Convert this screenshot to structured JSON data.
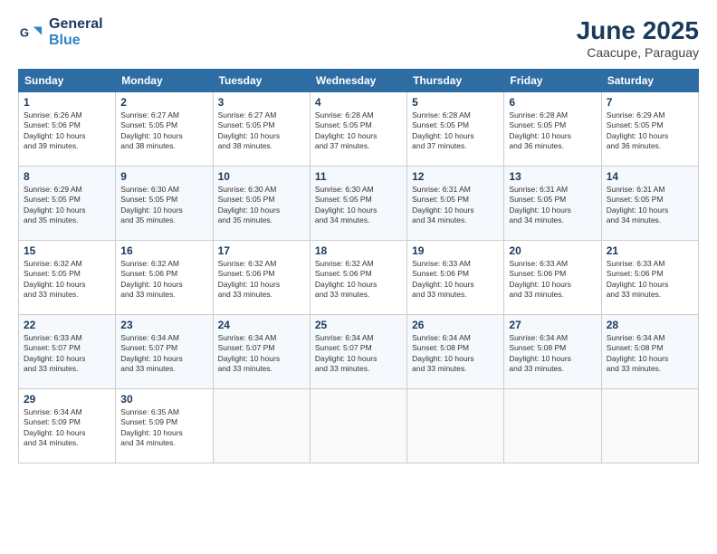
{
  "logo": {
    "line1": "General",
    "line2": "Blue"
  },
  "title": "June 2025",
  "subtitle": "Caacupe, Paraguay",
  "days_of_week": [
    "Sunday",
    "Monday",
    "Tuesday",
    "Wednesday",
    "Thursday",
    "Friday",
    "Saturday"
  ],
  "weeks": [
    [
      {
        "day": 1,
        "info": "Sunrise: 6:26 AM\nSunset: 5:06 PM\nDaylight: 10 hours\nand 39 minutes."
      },
      {
        "day": 2,
        "info": "Sunrise: 6:27 AM\nSunset: 5:05 PM\nDaylight: 10 hours\nand 38 minutes."
      },
      {
        "day": 3,
        "info": "Sunrise: 6:27 AM\nSunset: 5:05 PM\nDaylight: 10 hours\nand 38 minutes."
      },
      {
        "day": 4,
        "info": "Sunrise: 6:28 AM\nSunset: 5:05 PM\nDaylight: 10 hours\nand 37 minutes."
      },
      {
        "day": 5,
        "info": "Sunrise: 6:28 AM\nSunset: 5:05 PM\nDaylight: 10 hours\nand 37 minutes."
      },
      {
        "day": 6,
        "info": "Sunrise: 6:28 AM\nSunset: 5:05 PM\nDaylight: 10 hours\nand 36 minutes."
      },
      {
        "day": 7,
        "info": "Sunrise: 6:29 AM\nSunset: 5:05 PM\nDaylight: 10 hours\nand 36 minutes."
      }
    ],
    [
      {
        "day": 8,
        "info": "Sunrise: 6:29 AM\nSunset: 5:05 PM\nDaylight: 10 hours\nand 35 minutes."
      },
      {
        "day": 9,
        "info": "Sunrise: 6:30 AM\nSunset: 5:05 PM\nDaylight: 10 hours\nand 35 minutes."
      },
      {
        "day": 10,
        "info": "Sunrise: 6:30 AM\nSunset: 5:05 PM\nDaylight: 10 hours\nand 35 minutes."
      },
      {
        "day": 11,
        "info": "Sunrise: 6:30 AM\nSunset: 5:05 PM\nDaylight: 10 hours\nand 34 minutes."
      },
      {
        "day": 12,
        "info": "Sunrise: 6:31 AM\nSunset: 5:05 PM\nDaylight: 10 hours\nand 34 minutes."
      },
      {
        "day": 13,
        "info": "Sunrise: 6:31 AM\nSunset: 5:05 PM\nDaylight: 10 hours\nand 34 minutes."
      },
      {
        "day": 14,
        "info": "Sunrise: 6:31 AM\nSunset: 5:05 PM\nDaylight: 10 hours\nand 34 minutes."
      }
    ],
    [
      {
        "day": 15,
        "info": "Sunrise: 6:32 AM\nSunset: 5:05 PM\nDaylight: 10 hours\nand 33 minutes."
      },
      {
        "day": 16,
        "info": "Sunrise: 6:32 AM\nSunset: 5:06 PM\nDaylight: 10 hours\nand 33 minutes."
      },
      {
        "day": 17,
        "info": "Sunrise: 6:32 AM\nSunset: 5:06 PM\nDaylight: 10 hours\nand 33 minutes."
      },
      {
        "day": 18,
        "info": "Sunrise: 6:32 AM\nSunset: 5:06 PM\nDaylight: 10 hours\nand 33 minutes."
      },
      {
        "day": 19,
        "info": "Sunrise: 6:33 AM\nSunset: 5:06 PM\nDaylight: 10 hours\nand 33 minutes."
      },
      {
        "day": 20,
        "info": "Sunrise: 6:33 AM\nSunset: 5:06 PM\nDaylight: 10 hours\nand 33 minutes."
      },
      {
        "day": 21,
        "info": "Sunrise: 6:33 AM\nSunset: 5:06 PM\nDaylight: 10 hours\nand 33 minutes."
      }
    ],
    [
      {
        "day": 22,
        "info": "Sunrise: 6:33 AM\nSunset: 5:07 PM\nDaylight: 10 hours\nand 33 minutes."
      },
      {
        "day": 23,
        "info": "Sunrise: 6:34 AM\nSunset: 5:07 PM\nDaylight: 10 hours\nand 33 minutes."
      },
      {
        "day": 24,
        "info": "Sunrise: 6:34 AM\nSunset: 5:07 PM\nDaylight: 10 hours\nand 33 minutes."
      },
      {
        "day": 25,
        "info": "Sunrise: 6:34 AM\nSunset: 5:07 PM\nDaylight: 10 hours\nand 33 minutes."
      },
      {
        "day": 26,
        "info": "Sunrise: 6:34 AM\nSunset: 5:08 PM\nDaylight: 10 hours\nand 33 minutes."
      },
      {
        "day": 27,
        "info": "Sunrise: 6:34 AM\nSunset: 5:08 PM\nDaylight: 10 hours\nand 33 minutes."
      },
      {
        "day": 28,
        "info": "Sunrise: 6:34 AM\nSunset: 5:08 PM\nDaylight: 10 hours\nand 33 minutes."
      }
    ],
    [
      {
        "day": 29,
        "info": "Sunrise: 6:34 AM\nSunset: 5:09 PM\nDaylight: 10 hours\nand 34 minutes."
      },
      {
        "day": 30,
        "info": "Sunrise: 6:35 AM\nSunset: 5:09 PM\nDaylight: 10 hours\nand 34 minutes."
      },
      null,
      null,
      null,
      null,
      null
    ]
  ]
}
